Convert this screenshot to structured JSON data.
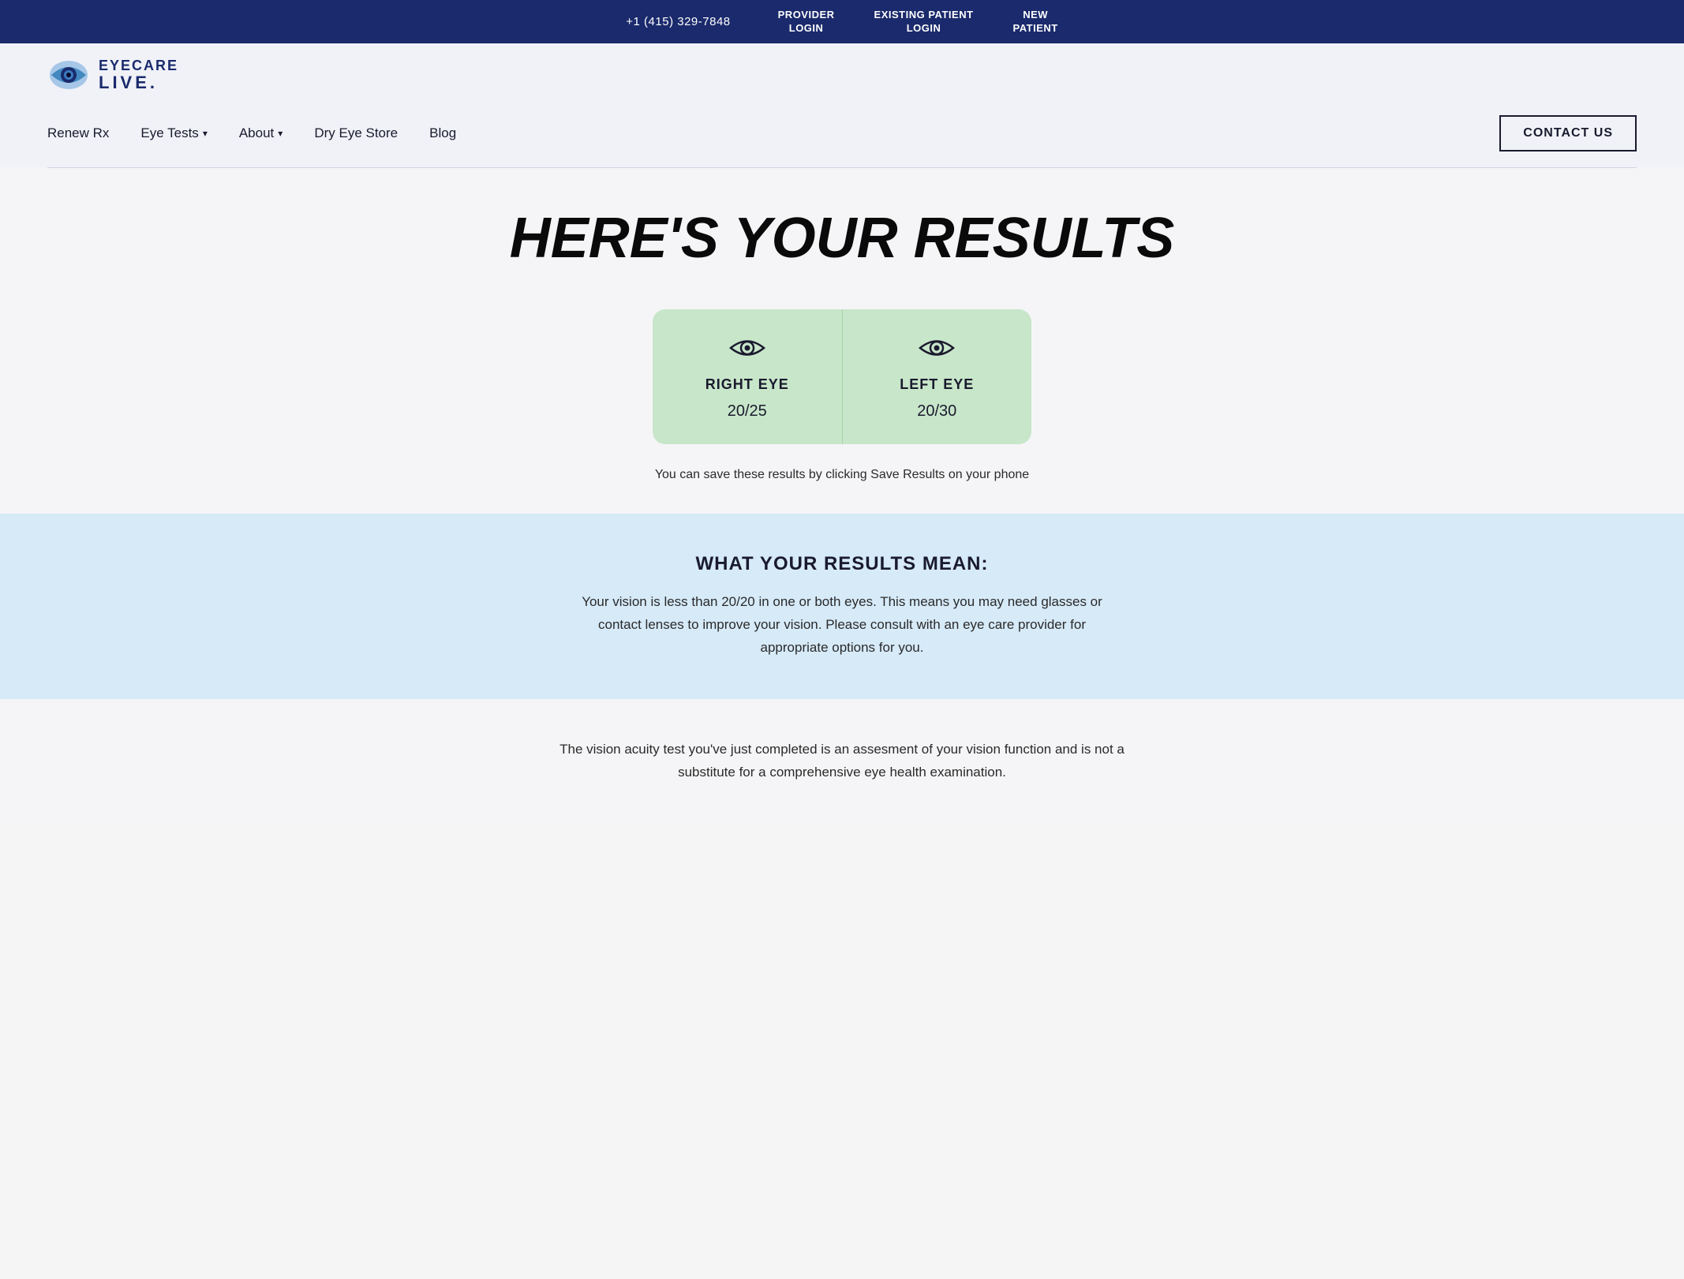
{
  "top_bar": {
    "phone": "+1 (415) 329-7848",
    "links": [
      {
        "id": "provider-login",
        "label": "PROVIDER\nLOGIN"
      },
      {
        "id": "existing-patient-login",
        "label": "EXISTING PATIENT\nLOGIN"
      },
      {
        "id": "new-patient",
        "label": "NEW\nPATIENT"
      }
    ]
  },
  "logo": {
    "eyecare": "EYECARE",
    "live": "LIVE."
  },
  "nav": {
    "items": [
      {
        "id": "renew-rx",
        "label": "Renew Rx",
        "has_chevron": false
      },
      {
        "id": "eye-tests",
        "label": "Eye Tests",
        "has_chevron": true
      },
      {
        "id": "about",
        "label": "About",
        "has_chevron": true
      },
      {
        "id": "dry-eye-store",
        "label": "Dry Eye Store",
        "has_chevron": false
      },
      {
        "id": "blog",
        "label": "Blog",
        "has_chevron": false
      }
    ],
    "contact_btn": "CONTACT US"
  },
  "main": {
    "title": "HERE'S YOUR RESULTS",
    "right_eye": {
      "label": "RIGHT EYE",
      "value": "20/25"
    },
    "left_eye": {
      "label": "LEFT EYE",
      "value": "20/30"
    },
    "save_hint": "You can save these results by clicking Save Results on your phone"
  },
  "results_meaning": {
    "title": "WHAT YOUR RESULTS MEAN:",
    "text": "Your vision is less than 20/20 in one or both eyes. This means you may need glasses or contact lenses to improve your vision. Please consult with an eye care provider for appropriate options for you."
  },
  "footer_section": {
    "text": "The vision acuity test you've just completed is an assesment of your vision function and is not a substitute for a comprehensive eye health examination."
  }
}
